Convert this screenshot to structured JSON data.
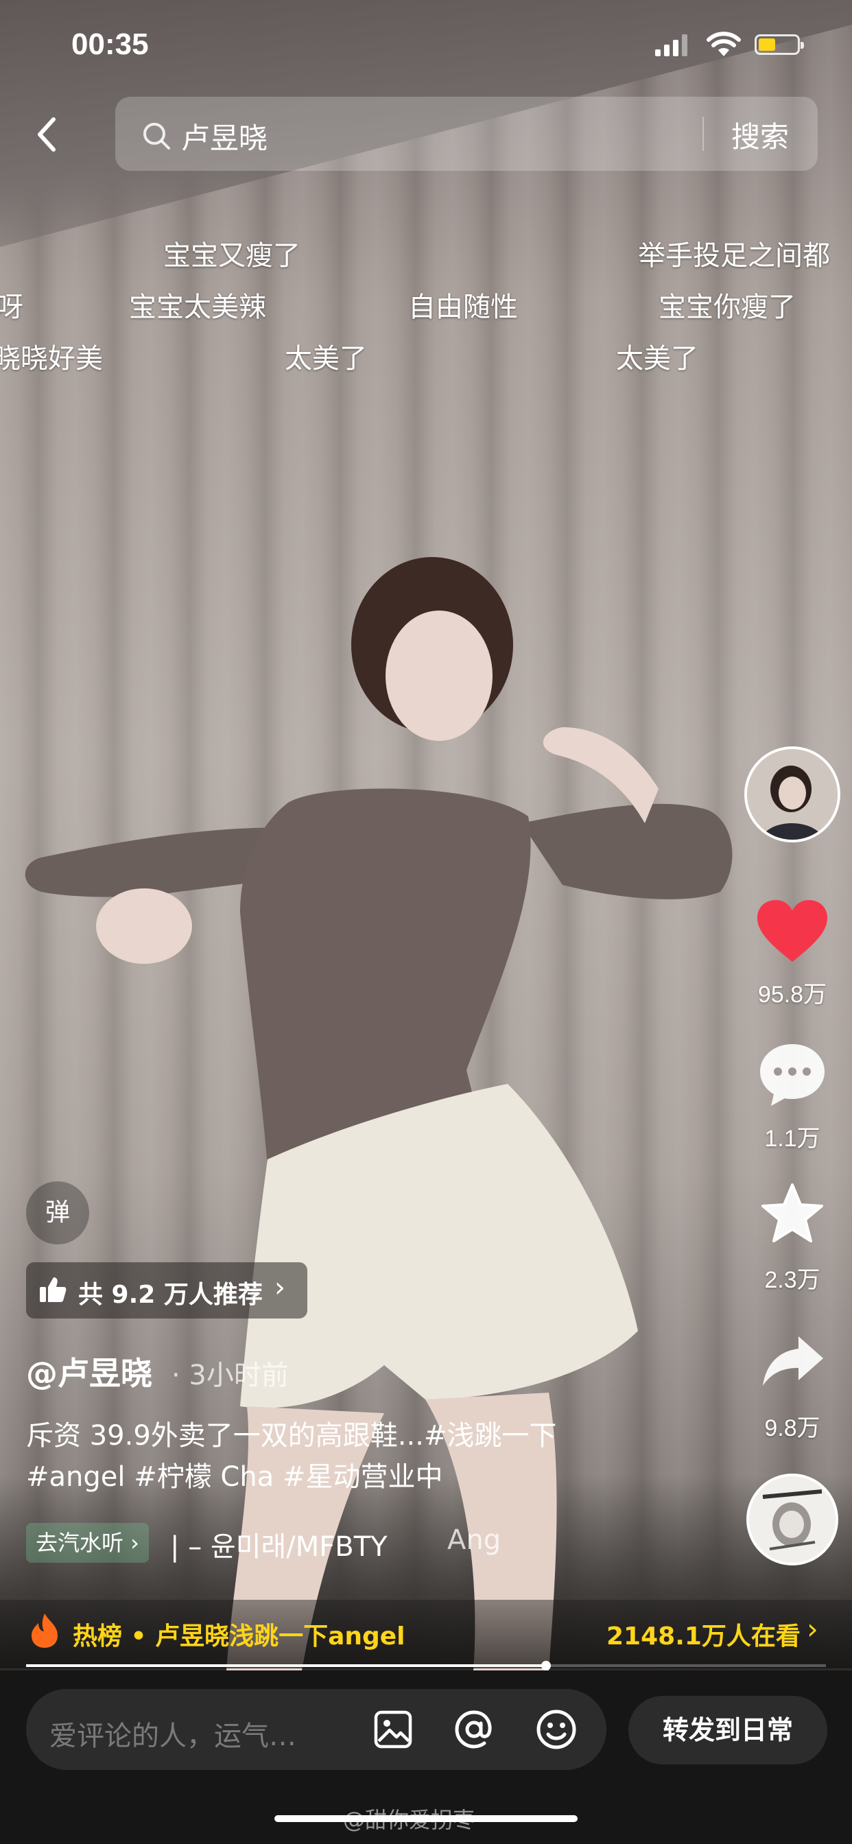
{
  "status": {
    "time": "00:35"
  },
  "search": {
    "query": "卢昱晓",
    "button": "搜索"
  },
  "danmaku": [
    "宝宝又瘦了",
    "举手投足之间都",
    "呀",
    "宝宝太美辣",
    "自由随性",
    "宝宝你瘦了",
    "晓晓好美",
    "太美了",
    "太美了"
  ],
  "actions": {
    "likes": "95.8万",
    "comments": "1.1万",
    "favorites": "2.3万",
    "shares": "9.8万",
    "like_color": "#f5364a"
  },
  "danmu_toggle": "弹",
  "recommend": "共 9.2 万人推荐",
  "post": {
    "author": "@卢昱晓",
    "time": "· 3小时前",
    "caption_line1": "斥资 39.9外卖了一双的高跟鞋...#浅跳一下",
    "caption_line2": "#angel #柠檬 Cha #星动营业中"
  },
  "music": {
    "badge": "去汽水听 ›",
    "title": "| – 윤미래/MFBTY",
    "title2": "Ang"
  },
  "hot": {
    "text": "热榜 • 卢昱晓浅跳一下angel",
    "count": "2148.1万人在看",
    "color": "#ffd51a"
  },
  "progress": 0.65,
  "composer": {
    "placeholder": "爱评论的人，运气…",
    "forward": "转发到日常"
  },
  "watermark": "@甜你爱拐枣"
}
